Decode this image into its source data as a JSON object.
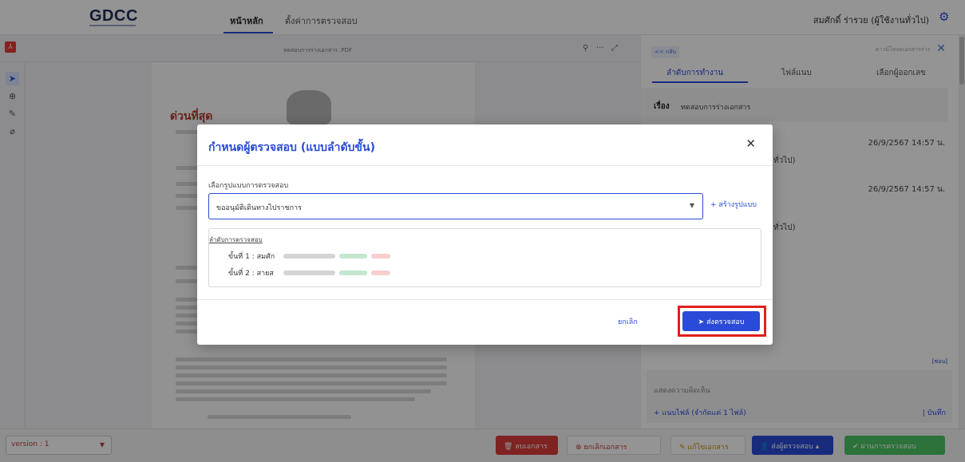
{
  "app": {
    "logo": "GDCC",
    "nav": [
      "หน้าหลัก",
      "ตั้งค่าการตรวจสอบ"
    ],
    "user": "สมศักดิ์ ร่ารวย (ผู้ใช้งานทั่วไป)"
  },
  "viewer": {
    "filename": "ทดสอบการร่างเอกสาร .PDF",
    "doc_heading": "ด่วนที่สุด"
  },
  "right_panel": {
    "back": "<< กลับ",
    "download": "ดาวน์โหลดเอกสารร่าง",
    "tabs": [
      "ลำดับการทำงาน",
      "ไฟล์แนบ",
      "เลือกผู้ออกเลข"
    ],
    "subject_label": "เรื่อง",
    "subject_value": "ทดสอบการร่างเอกสาร",
    "entries": [
      {
        "time": "26/9/2567 14:57 น.",
        "role": "ทั่วไป)"
      },
      {
        "time": "26/9/2567 14:57 น.",
        "role": "ทั่วไป)"
      }
    ],
    "collapse": "[ซ่อน]",
    "comment_placeholder": "แสดงความคิดเห็น",
    "attach": "+  แนบไฟล์ (จำกัดแค่ 1 ไฟล์)",
    "save": "| บันทึก"
  },
  "bottom": {
    "version": "version : 1",
    "buttons": {
      "delete": "ลบเอกสาร",
      "cancel_doc": "ยกเลิกเอกสาร",
      "edit": "แก้ไขเอกสาร",
      "send": "ส่งผู้ตรวจสอบ ▴",
      "pass": "ผ่านการตรวจสอบ"
    }
  },
  "modal": {
    "title": "กำหนดผู้ตรวจสอบ (แบบลำดับขั้น)",
    "select_label": "เลือกรูปแบบการตรวจสอบ",
    "select_value": "ขออนุมัติเดินทางไปราชการ",
    "create_link": "+ สร้างรูปแบบ",
    "order_title": "ลำดับการตรวจสอบ",
    "steps": [
      "ขั้นที่ 1 : สมศัก",
      "ขั้นที่ 2 : สายส"
    ],
    "cancel": "ยกเลิก",
    "submit": "ส่งตรวจสอบ"
  }
}
